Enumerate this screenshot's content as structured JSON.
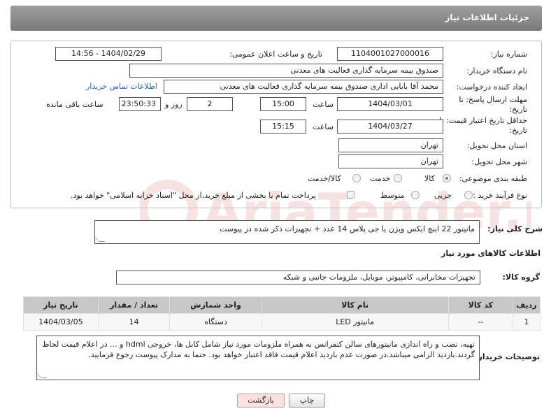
{
  "header": {
    "title": "جزئیات اطلاعات نیاز"
  },
  "form": {
    "need_number_label": "شماره نیاز:",
    "need_number": "1104001027000016",
    "announce_label": "تاریخ و ساعت اعلان عمومی:",
    "announce_value": "1404/02/29 - 14:56",
    "buyer_org_label": "نام دستگاه خریدار:",
    "buyer_org": "صندوق بیمه سرمایه گذاری فعالیت های معدنی",
    "requester_label": "ایجاد کننده درخواست:",
    "requester": "محمد آقا بابایی اداری صندوق بیمه سرمایه گذاری فعالیت های معدنی",
    "contact_link": "اطلاعات تماس خریدار",
    "deadline_label": "مهلت ارسال پاسخ: تا تاریخ:",
    "deadline_date": "1404/03/01",
    "time_label": "ساعت",
    "deadline_time": "15:00",
    "days_value": "2",
    "days_label": "روز و",
    "remaining_time": "23:50:33",
    "remaining_label": "ساعت باقی مانده",
    "validity_label": "حداقل تاریخ اعتبار قیمت: تا تاریخ:",
    "validity_date": "1404/03/27",
    "validity_time_label": "ساعت",
    "validity_time": "15:15",
    "province_label": "استان محل تحویل:",
    "province": "تهران",
    "city_label": "شهر محل تحویل:",
    "city": "تهران",
    "category_label": "طبقه بندی موضوعی:",
    "category_options": [
      "کالا",
      "خدمت",
      "کالا/خدمت"
    ],
    "category_selected": "کالا",
    "process_label": "نوع فرآیند خرید :",
    "process_options": [
      "جزیی",
      "متوسط"
    ],
    "process_selected": "",
    "payment_note": "پرداخت تمام یا بخشی از مبلغ خرید،از محل \"اسناد خزانه اسلامی\" خواهد بود."
  },
  "summary": {
    "label": "شرح کلی نیاز:",
    "text": "مانیتور 22 اینچ ایکس ویژن یا جی پلاس 14 عدد + تجهیزات ذکر شده در پیوست"
  },
  "goods": {
    "section_title": "اطلاعات کالاهای مورد نیاز",
    "group_label": "گروه کالا:",
    "group_value": "تجهیزات مخابراتی، کامپیوتر، موبایل، ملزومات جانبی و شبکه",
    "columns": [
      "ردیف",
      "کد کالا",
      "نام کالا",
      "واحد شمارش",
      "تعداد / مقدار",
      "تاریخ نیاز"
    ],
    "rows": [
      {
        "index": "1",
        "code": "--",
        "name": "مانیتور LED",
        "unit": "دستگاه",
        "qty": "14",
        "date": "1404/03/05"
      }
    ]
  },
  "buyer_notes": {
    "label": "توضیحات خریدار:",
    "text": "تهیه، نصب و راه اندازی مانیتورهای سالن کنفرانس به همراه ملزومات مورد نیاز شامل کابل ها، خروجی hdmi و ... در اعلام قیمت لحاظ گردند.بازدید الزامی میباشد.در صورت عدم بازدید اعلام قیمت فاقد اعتبار خواهد بود. حتما به مدارک پیوست رجوع فرمایید."
  },
  "buttons": {
    "print": "چاپ",
    "back": "بازگشت"
  },
  "watermark": {
    "text": "AriaTender.neT",
    "brand_color": "#c62828"
  }
}
